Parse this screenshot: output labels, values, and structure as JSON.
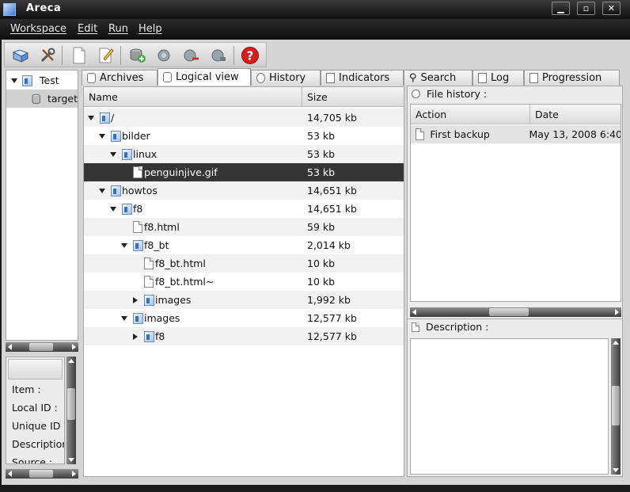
{
  "window": {
    "title": "Areca",
    "minimize": "▁",
    "maximize": "▫",
    "close": "✕"
  },
  "menu": [
    "Workspace",
    "Edit",
    "Run",
    "Help"
  ],
  "toolbar": {
    "icons": [
      "open-workspace-icon",
      "properties-tools-icon",
      "new-document-icon",
      "edit-icon",
      "add-target-icon",
      "backup-icon",
      "remove-icon",
      "archive-icon",
      "help-icon"
    ]
  },
  "left_tree": {
    "items": [
      {
        "label": "Test"
      },
      {
        "label": "target"
      }
    ]
  },
  "info_panel": {
    "labels": [
      "Item :",
      "Local ID :",
      "Unique ID :",
      "Description",
      "Source :"
    ]
  },
  "tabs": [
    {
      "label": "Archives",
      "active": false
    },
    {
      "label": "Logical view",
      "active": true
    },
    {
      "label": "History",
      "active": false
    },
    {
      "label": "Indicators",
      "active": false
    },
    {
      "label": "Search",
      "active": false
    },
    {
      "label": "Log",
      "active": false
    },
    {
      "label": "Progression",
      "active": false
    }
  ],
  "file_table": {
    "headers": {
      "name": "Name",
      "size": "Size"
    },
    "rows": [
      {
        "name": "/",
        "size": "14,705 kb",
        "kind": "folder",
        "depth": 0,
        "toggle": "down"
      },
      {
        "name": "bilder",
        "size": "53 kb",
        "kind": "folder",
        "depth": 1,
        "toggle": "down"
      },
      {
        "name": "linux",
        "size": "53 kb",
        "kind": "folder",
        "depth": 2,
        "toggle": "down"
      },
      {
        "name": "penguinjive.gif",
        "size": "53 kb",
        "kind": "file",
        "depth": 3,
        "toggle": "none",
        "selected": true
      },
      {
        "name": "howtos",
        "size": "14,651 kb",
        "kind": "folder",
        "depth": 1,
        "toggle": "down"
      },
      {
        "name": "f8",
        "size": "14,651 kb",
        "kind": "folder",
        "depth": 2,
        "toggle": "down"
      },
      {
        "name": "f8.html",
        "size": "59 kb",
        "kind": "file",
        "depth": 3,
        "toggle": "none"
      },
      {
        "name": "f8_bt",
        "size": "2,014 kb",
        "kind": "folder",
        "depth": 3,
        "toggle": "down"
      },
      {
        "name": "f8_bt.html",
        "size": "10 kb",
        "kind": "file",
        "depth": 4,
        "toggle": "none"
      },
      {
        "name": "f8_bt.html~",
        "size": "10 kb",
        "kind": "file",
        "depth": 4,
        "toggle": "none"
      },
      {
        "name": "images",
        "size": "1,992 kb",
        "kind": "folder",
        "depth": 4,
        "toggle": "right"
      },
      {
        "name": "images",
        "size": "12,577 kb",
        "kind": "folder",
        "depth": 3,
        "toggle": "down"
      },
      {
        "name": "f8",
        "size": "12,577 kb",
        "kind": "folder",
        "depth": 4,
        "toggle": "right"
      }
    ]
  },
  "file_history": {
    "title": "File history :",
    "headers": {
      "action": "Action",
      "date": "Date"
    },
    "rows": [
      {
        "action": "First backup",
        "date": "May 13, 2008 6:40"
      }
    ]
  },
  "description": {
    "title": "Description :"
  }
}
